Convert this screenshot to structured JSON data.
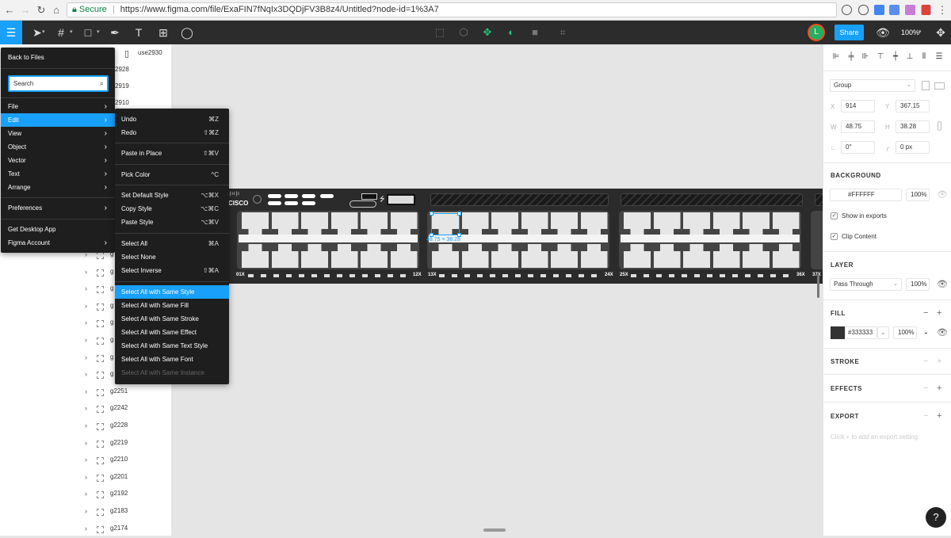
{
  "browser": {
    "security_label": "Secure",
    "url": "https://www.figma.com/file/ExaFIN7fNqIx3DQDjFV3B8z4/Untitled?node-id=1%3A7"
  },
  "toolbar": {
    "avatar_letter": "L",
    "share_label": "Share",
    "zoom_label": "100%"
  },
  "main_menu": {
    "back_label": "Back to Files",
    "search_placeholder": "Search",
    "items": [
      {
        "label": "File"
      },
      {
        "label": "Edit"
      },
      {
        "label": "View"
      },
      {
        "label": "Object"
      },
      {
        "label": "Vector"
      },
      {
        "label": "Text"
      },
      {
        "label": "Arrange"
      }
    ],
    "preferences_label": "Preferences",
    "desktop_label": "Get Desktop App",
    "account_label": "Figma Account"
  },
  "edit_menu": {
    "items": [
      {
        "label": "Undo",
        "shortcut": "⌘Z"
      },
      {
        "label": "Redo",
        "shortcut": "⇧⌘Z"
      },
      {
        "label": "Paste in Place",
        "shortcut": "⇧⌘V"
      },
      {
        "label": "Pick Color",
        "shortcut": "^C"
      },
      {
        "label": "Set Default Style",
        "shortcut": "⌥⌘X"
      },
      {
        "label": "Copy Style",
        "shortcut": "⌥⌘C"
      },
      {
        "label": "Paste Style",
        "shortcut": "⌥⌘V"
      },
      {
        "label": "Select All",
        "shortcut": "⌘A"
      },
      {
        "label": "Select None",
        "shortcut": ""
      },
      {
        "label": "Select Inverse",
        "shortcut": "⇧⌘A"
      },
      {
        "label": "Select All with Same Style",
        "shortcut": ""
      },
      {
        "label": "Select All with Same Fill",
        "shortcut": ""
      },
      {
        "label": "Select All with Same Stroke",
        "shortcut": ""
      },
      {
        "label": "Select All with Same Effect",
        "shortcut": ""
      },
      {
        "label": "Select All with Same Text Style",
        "shortcut": ""
      },
      {
        "label": "Select All with Same Font",
        "shortcut": ""
      },
      {
        "label": "Select All with Same Instance",
        "shortcut": ""
      }
    ]
  },
  "layers": {
    "top": [
      {
        "name": "use2930"
      },
      {
        "name": "2928"
      },
      {
        "name": "2919"
      },
      {
        "name": "2910"
      }
    ],
    "rows": [
      {
        "name": "g"
      },
      {
        "name": "g"
      },
      {
        "name": "g"
      },
      {
        "name": "g"
      },
      {
        "name": "g"
      },
      {
        "name": "g"
      },
      {
        "name": "g"
      },
      {
        "name": "g"
      },
      {
        "name": "g2251"
      },
      {
        "name": "g2242"
      },
      {
        "name": "g2228"
      },
      {
        "name": "g2219"
      },
      {
        "name": "g2210"
      },
      {
        "name": "g2201"
      },
      {
        "name": "g2192"
      },
      {
        "name": "g2183"
      },
      {
        "name": "g2174"
      }
    ]
  },
  "canvas": {
    "brand": "cisco",
    "port_labels": [
      "01X",
      "12X",
      "13X",
      "24X",
      "25X",
      "36X",
      "37X"
    ],
    "selection_size": "48.75 × 38.28"
  },
  "properties": {
    "frame_type": "Group",
    "x_label": "X",
    "x_value": "914",
    "y_label": "Y",
    "y_value": "367.15",
    "w_label": "W",
    "w_value": "48.75",
    "h_label": "H",
    "h_value": "38.28",
    "rotation_value": "0°",
    "radius_value": "0 px",
    "background_title": "BACKGROUND",
    "background_color": "#FFFFFF",
    "background_opacity": "100%",
    "show_exports_label": "Show in exports",
    "clip_content_label": "Clip Content",
    "layer_title": "LAYER",
    "blend_mode": "Pass Through",
    "layer_opacity": "100%",
    "fill_title": "FILL",
    "fill_color": "#333333",
    "fill_opacity": "100%",
    "stroke_title": "STROKE",
    "effects_title": "EFFECTS",
    "export_title": "EXPORT",
    "export_hint": "Click + to add an export setting"
  },
  "help_label": "?",
  "colors": {
    "accent": "#18a0fb",
    "toolbar": "#2c2c2c",
    "menu": "#1e1e1e",
    "canvas": "#e5e5e5"
  }
}
